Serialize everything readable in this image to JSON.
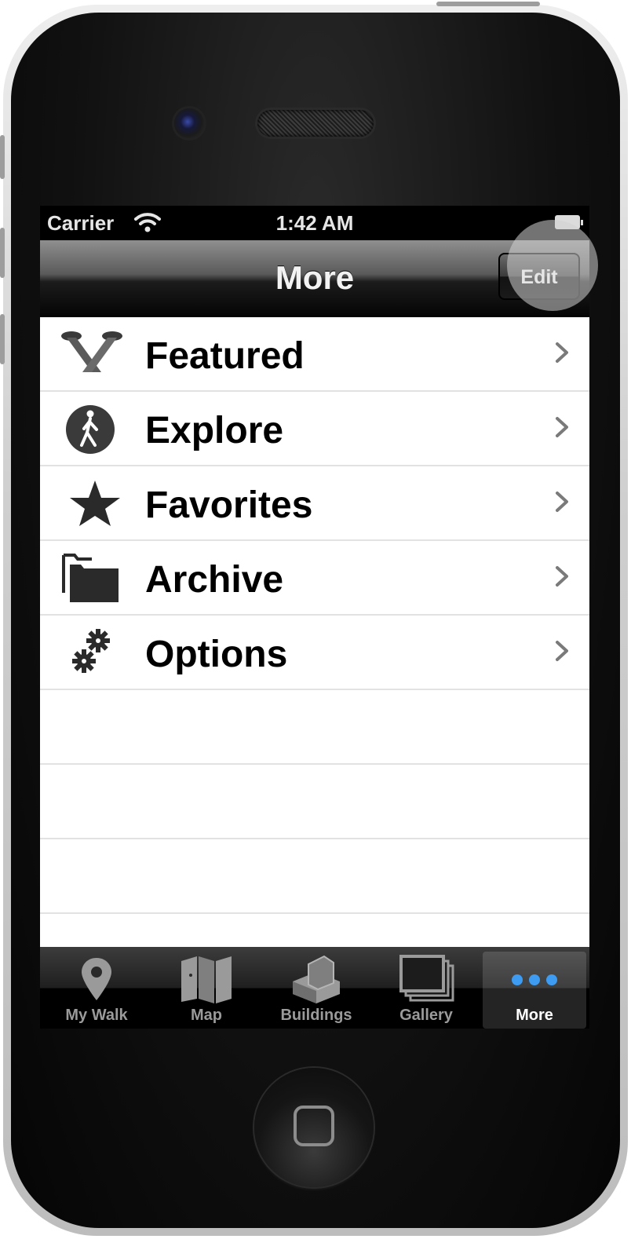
{
  "status_bar": {
    "carrier": "Carrier",
    "time": "1:42 AM",
    "wifi_icon": "wifi-icon",
    "battery_icon": "battery-icon"
  },
  "nav_bar": {
    "title": "More",
    "edit_label": "Edit"
  },
  "menu": {
    "items": [
      {
        "label": "Featured",
        "icon": "spotlight-icon"
      },
      {
        "label": "Explore",
        "icon": "pedestrian-icon"
      },
      {
        "label": "Favorites",
        "icon": "star-icon"
      },
      {
        "label": "Archive",
        "icon": "folder-icon"
      },
      {
        "label": "Options",
        "icon": "gears-icon"
      }
    ]
  },
  "tab_bar": {
    "tabs": [
      {
        "label": "My Walk",
        "icon": "map-pin-icon",
        "selected": false
      },
      {
        "label": "Map",
        "icon": "folded-map-icon",
        "selected": false
      },
      {
        "label": "Buildings",
        "icon": "buildings-icon",
        "selected": false
      },
      {
        "label": "Gallery",
        "icon": "photo-stack-icon",
        "selected": false
      },
      {
        "label": "More",
        "icon": "more-dots-icon",
        "selected": true
      }
    ]
  },
  "colors": {
    "accent_blue": "#3d9bf2",
    "navbar_dark": "#1c1c1c",
    "tab_inactive": "#9a9a9a"
  }
}
